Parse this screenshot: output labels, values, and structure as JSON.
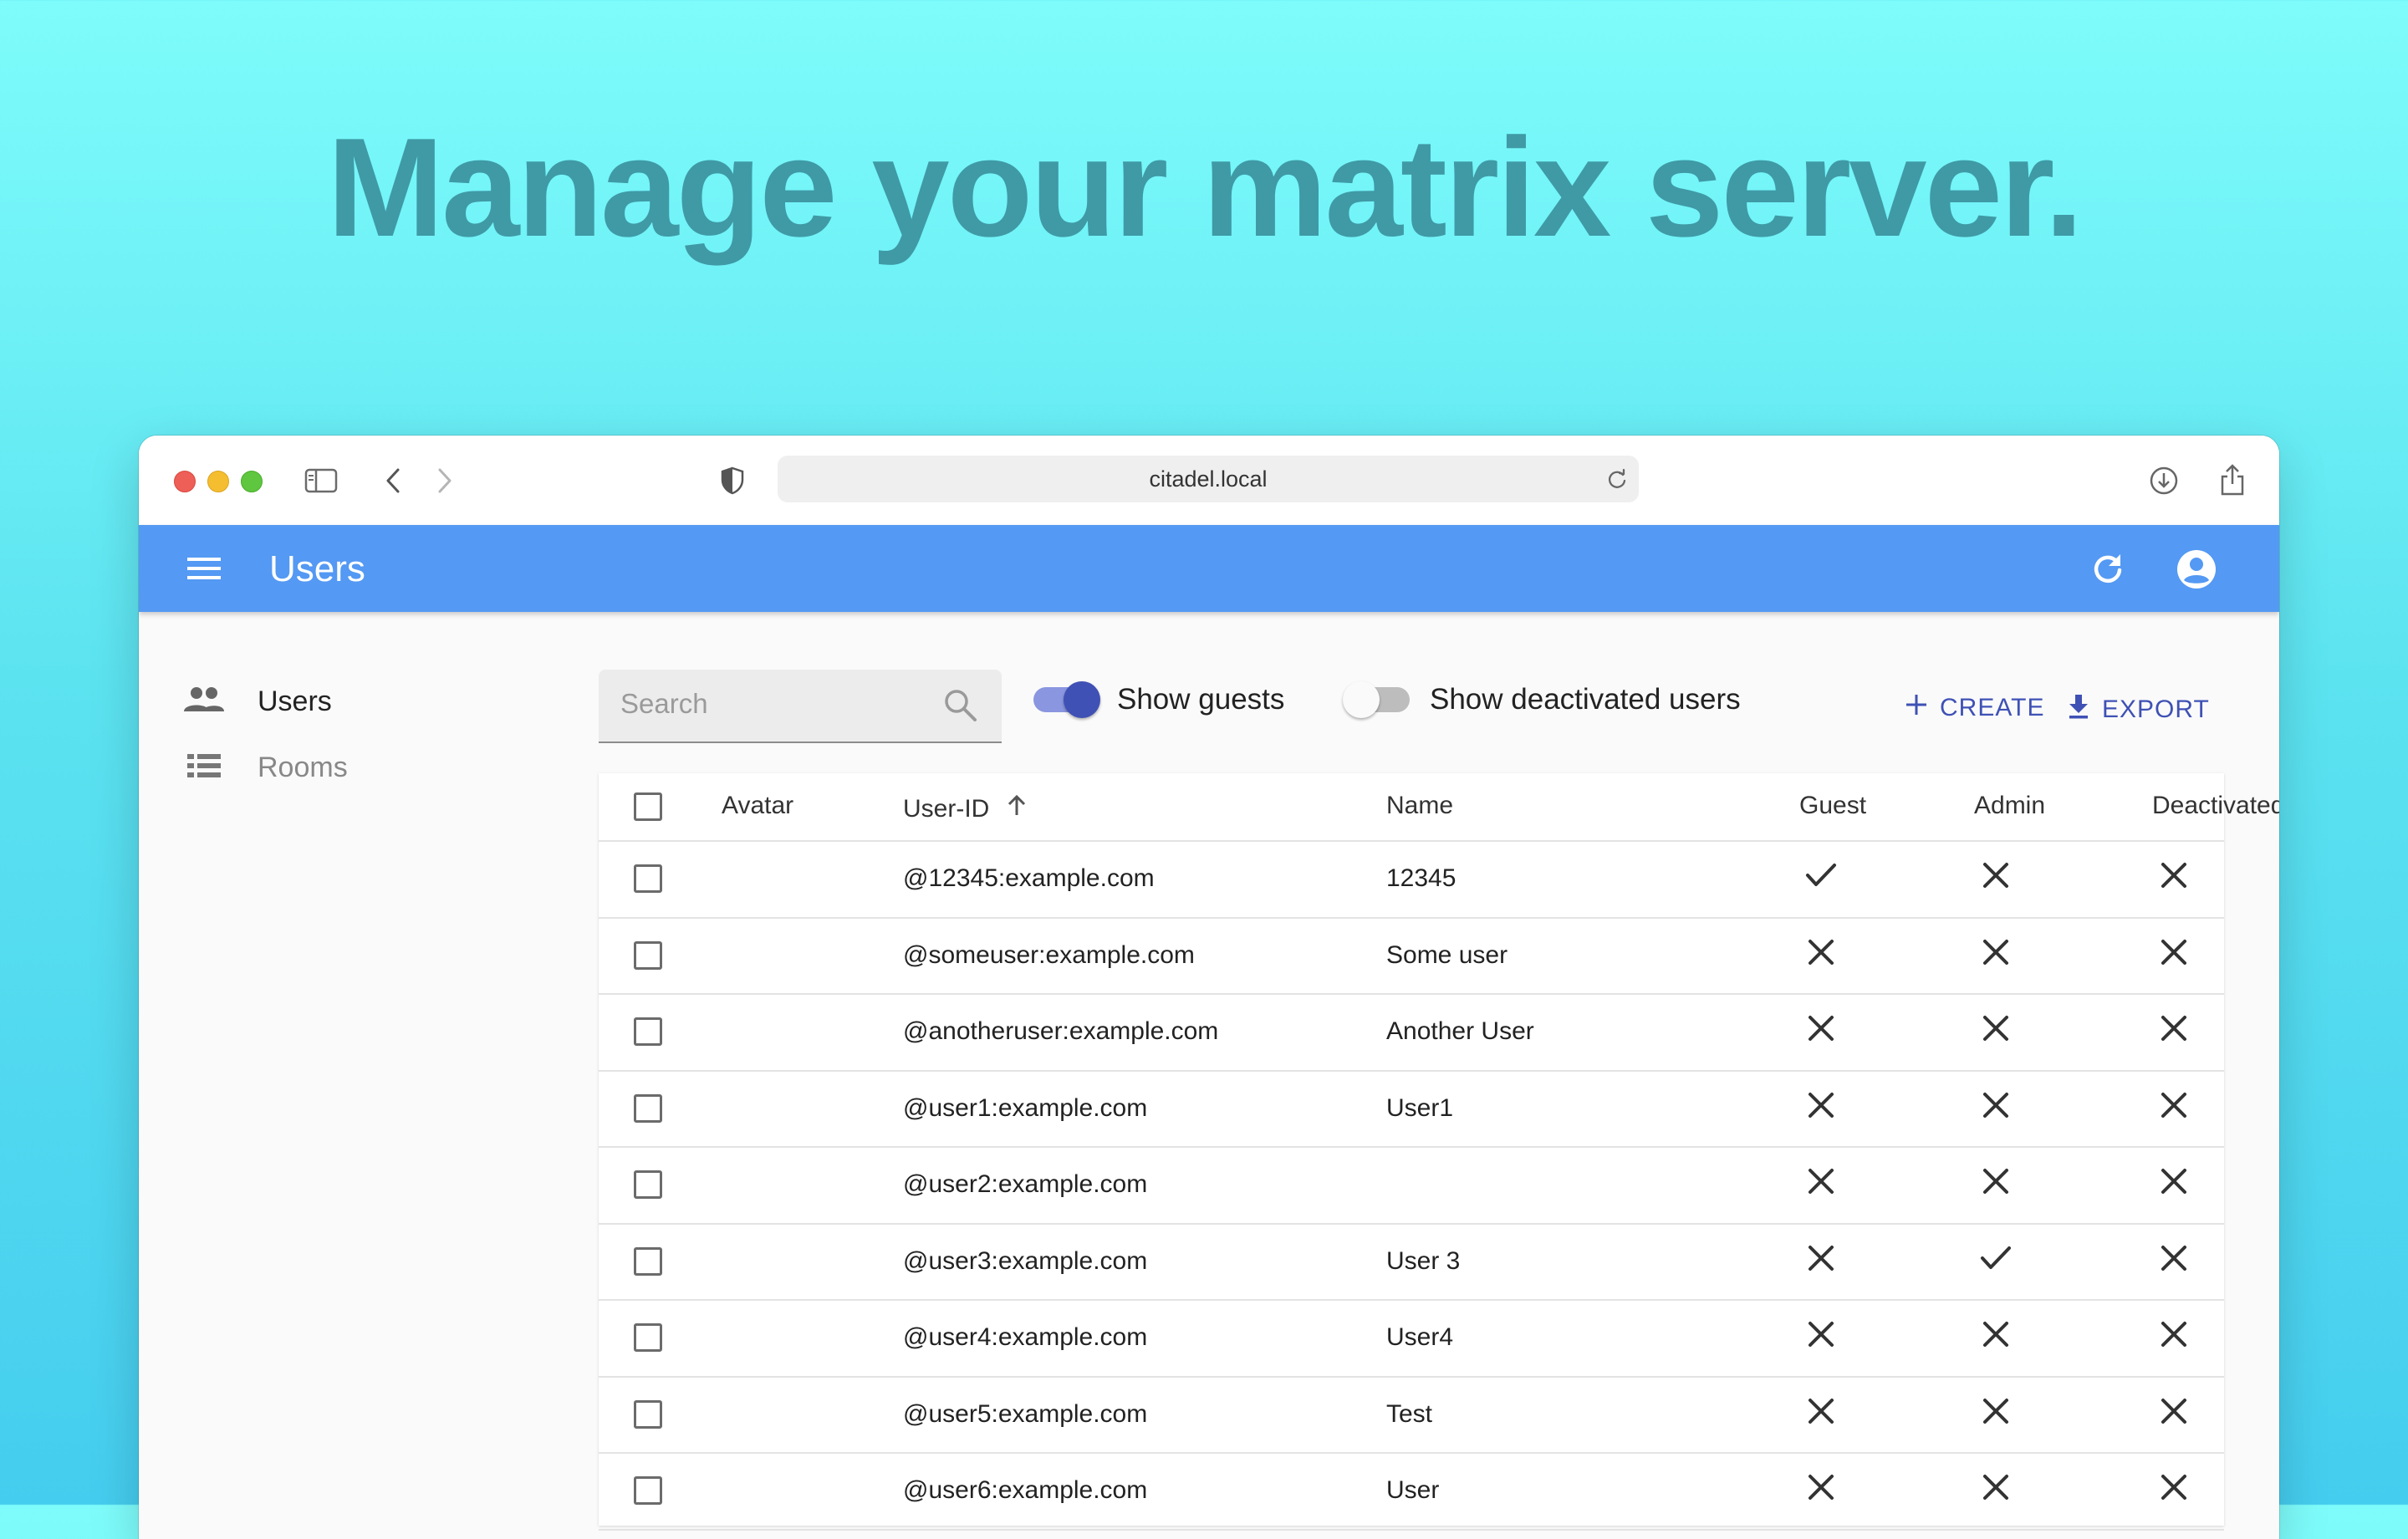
{
  "headline": "Manage your matrix server.",
  "browser": {
    "url": "citadel.local"
  },
  "appbar": {
    "title": "Users"
  },
  "sidebar": {
    "items": [
      {
        "label": "Users",
        "active": true
      },
      {
        "label": "Rooms",
        "active": false
      }
    ]
  },
  "filters": {
    "search_placeholder": "Search",
    "show_guests": {
      "label": "Show guests",
      "on": true
    },
    "show_deactivated": {
      "label": "Show deactivated users",
      "on": false
    }
  },
  "actions": {
    "create": "CREATE",
    "export": "EXPORT"
  },
  "table": {
    "headers": {
      "avatar": "Avatar",
      "user_id": "User-ID",
      "name": "Name",
      "guest": "Guest",
      "admin": "Admin",
      "deactivated": "Deactivated"
    },
    "rows": [
      {
        "user_id": "@12345:example.com",
        "name": "12345",
        "guest": true,
        "admin": false,
        "deactivated": false
      },
      {
        "user_id": "@someuser:example.com",
        "name": "Some user",
        "guest": false,
        "admin": false,
        "deactivated": false
      },
      {
        "user_id": "@anotheruser:example.com",
        "name": "Another User",
        "guest": false,
        "admin": false,
        "deactivated": false
      },
      {
        "user_id": "@user1:example.com",
        "name": "User1",
        "guest": false,
        "admin": false,
        "deactivated": false
      },
      {
        "user_id": "@user2:example.com",
        "name": "",
        "guest": false,
        "admin": false,
        "deactivated": false
      },
      {
        "user_id": "@user3:example.com",
        "name": "User 3",
        "guest": false,
        "admin": true,
        "deactivated": false
      },
      {
        "user_id": "@user4:example.com",
        "name": "User4",
        "guest": false,
        "admin": false,
        "deactivated": false
      },
      {
        "user_id": "@user5:example.com",
        "name": "Test",
        "guest": false,
        "admin": false,
        "deactivated": false
      },
      {
        "user_id": "@user6:example.com",
        "name": "User",
        "guest": false,
        "admin": false,
        "deactivated": false
      }
    ]
  },
  "colors": {
    "appbar": "#5499f3",
    "accent": "#3f51b5",
    "toggle_on_track": "#8a96e0",
    "toggle_on_thumb": "#3f51b5"
  },
  "icons": {
    "traffic_lights": [
      "close-dot",
      "minimize-dot",
      "zoom-dot"
    ],
    "toolbar": [
      "sidebar-icon",
      "back-icon",
      "forward-icon",
      "shield-icon",
      "reload-icon",
      "download-icon",
      "share-icon",
      "new-tab-icon",
      "tabs-icon"
    ],
    "appbar": [
      "menu-icon",
      "refresh-icon",
      "account-icon"
    ],
    "sidebar": [
      "people-icon",
      "list-icon"
    ],
    "table": [
      "sort-arrow-up-icon",
      "check-icon",
      "close-icon"
    ]
  }
}
